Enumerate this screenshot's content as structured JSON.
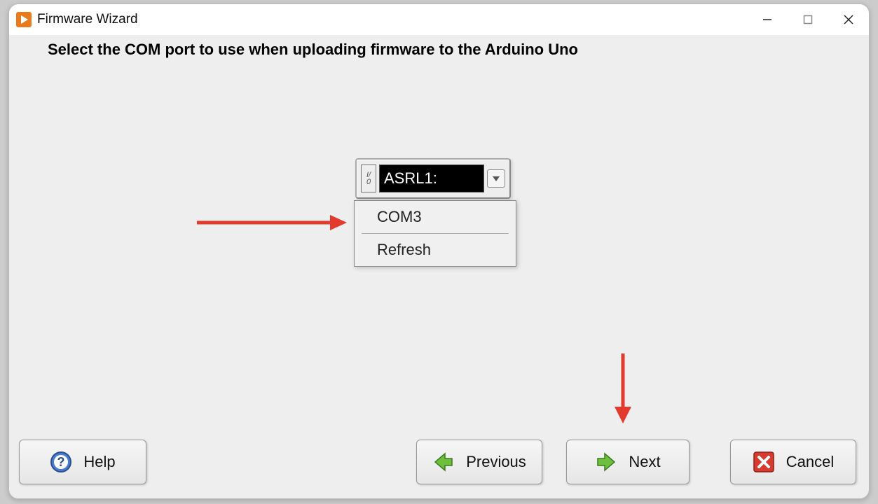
{
  "window": {
    "title": "Firmware Wizard"
  },
  "instruction": "Select the COM port to use when uploading firmware to the Arduino Uno",
  "combo": {
    "value": "ASRL1:",
    "io_label": "I/\n0"
  },
  "dropdown": {
    "options": [
      "COM3",
      "Refresh"
    ]
  },
  "buttons": {
    "help": "Help",
    "previous": "Previous",
    "next": "Next",
    "cancel": "Cancel"
  }
}
